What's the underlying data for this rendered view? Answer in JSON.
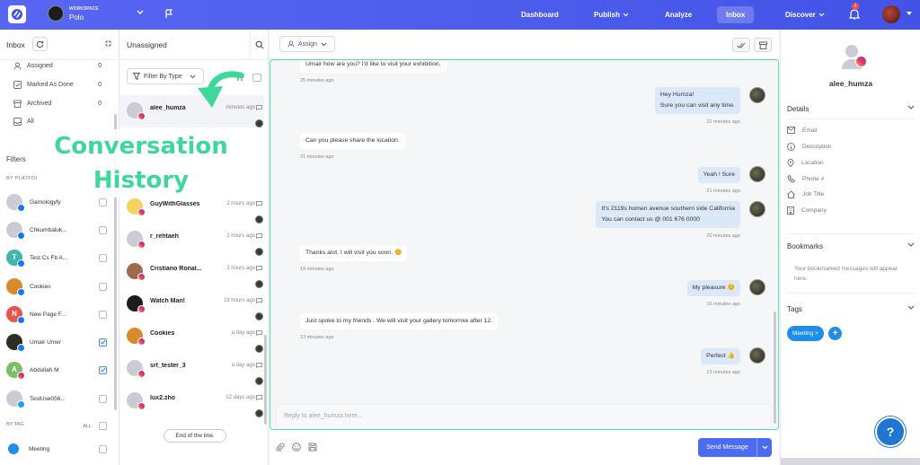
{
  "topbar": {
    "workspace_label": "WORKSPACE",
    "workspace_name": "Polo",
    "nav": [
      {
        "label": "Dashboard"
      },
      {
        "label": "Publish"
      },
      {
        "label": "Analyze"
      },
      {
        "label": "Inbox"
      },
      {
        "label": "Discover"
      }
    ],
    "notification_count": "1"
  },
  "inbox_panel": {
    "title": "Inbox",
    "items": [
      {
        "label": "Assigned",
        "count": "0"
      },
      {
        "label": "Marked As Done",
        "count": "0"
      },
      {
        "label": "Archived",
        "count": "0"
      },
      {
        "label": "All",
        "count": ""
      }
    ],
    "filters_title": "Filters",
    "by_platform_label": "BY PLATFOI",
    "accounts": [
      {
        "name": "Gamologyfy",
        "platform": "facebook",
        "checked": false,
        "avatar_color": "#c9ccd3"
      },
      {
        "name": "Chkumbaluk...",
        "platform": "facebook",
        "checked": false,
        "avatar_color": "#c9ccd3"
      },
      {
        "name": "Test Cs Fb A...",
        "platform": "facebook",
        "checked": false,
        "avatar_color": "#3fb6a8",
        "initial": "T"
      },
      {
        "name": "Cookies",
        "platform": "facebook",
        "checked": false,
        "avatar_color": "#d98a2b"
      },
      {
        "name": "New Page F...",
        "platform": "facebook",
        "checked": false,
        "avatar_color": "#e8534d",
        "initial": "N"
      },
      {
        "name": "Umair Umer",
        "platform": "facebook",
        "checked": true,
        "avatar_color": "#2d2d22"
      },
      {
        "name": "Abdullah M",
        "platform": "instagram",
        "checked": true,
        "avatar_color": "#7cbf6a",
        "initial": "A"
      },
      {
        "name": "TestUse056...",
        "platform": "twitter",
        "checked": false,
        "avatar_color": "#c9ccd3"
      }
    ],
    "by_tag_label": "BY TAG",
    "all_label": "ALL",
    "tags": [
      {
        "name": "Meeting",
        "color": "#1f8dea"
      }
    ]
  },
  "overlay": {
    "line1": "Conversation",
    "line2": "History"
  },
  "conversation_list": {
    "title": "Unassigned",
    "filter_label": "Filter By Type",
    "items": [
      {
        "name": "alee_humza",
        "time": "minutes ago",
        "avatar_color": "#c9ccd3",
        "platform": "instagram",
        "selected": true
      },
      {
        "name": "GuyWithGlasses",
        "time": "2 hours ago",
        "avatar_color": "#f4d35e",
        "platform": "instagram"
      },
      {
        "name": "r_rehtaeh",
        "time": "2 hours ago",
        "avatar_color": "#c9ccd3",
        "platform": "instagram"
      },
      {
        "name": "Cristiano Ronal...",
        "time": "2 hours ago",
        "avatar_color": "#a0694b",
        "platform": "instagram"
      },
      {
        "name": "Watch Man!",
        "time": "19 hours ago",
        "avatar_color": "#1d1d1d",
        "platform": "instagram"
      },
      {
        "name": "Cookies",
        "time": "a day ago",
        "avatar_color": "#d98a2b",
        "platform": "instagram"
      },
      {
        "name": "srt_tester_3",
        "time": "a day ago",
        "avatar_color": "#c9ccd3",
        "platform": "instagram"
      },
      {
        "name": "lux2.zho",
        "time": "12 days ago",
        "avatar_color": "#c9ccd3",
        "platform": "instagram"
      }
    ],
    "end_label": "End of the line."
  },
  "chat": {
    "assign_label": "Assign",
    "messages": [
      {
        "side": "in",
        "lines": [
          "Umair how are you? I'd like to visit your exhibition."
        ],
        "time": "25 minutes ago"
      },
      {
        "side": "out",
        "lines": [
          "Hey Humza!",
          "Sure you can visit any time."
        ],
        "time": "22 minutes ago"
      },
      {
        "side": "in",
        "lines": [
          "Can you please share the location."
        ],
        "time": "21 minutes ago"
      },
      {
        "side": "out",
        "lines": [
          "Yeah ! Sure"
        ],
        "time": "21 minutes ago"
      },
      {
        "side": "out",
        "lines": [
          "It's 2119s homen avenue southern side California",
          "You can contact us @ 001 676 0000"
        ],
        "time": "20 minutes ago"
      },
      {
        "side": "in",
        "lines": [
          "Thanks alot. I will visit you soon. 😊"
        ],
        "time": "19 minutes ago"
      },
      {
        "side": "out",
        "lines": [
          "My pleasure 😊"
        ],
        "time": "16 minutes ago"
      },
      {
        "side": "in",
        "lines": [
          "Just spoke to my friends . We will visit your gallery tomorrow after 12."
        ],
        "time": "13 minutes ago"
      },
      {
        "side": "out",
        "lines": [
          "Perfect 👍"
        ],
        "time": "13 minutes ago"
      }
    ],
    "reply_placeholder": "Reply to alee_humza here...",
    "send_label": "Send Message"
  },
  "profile": {
    "username": "alee_humza",
    "details_title": "Details",
    "details": [
      {
        "label": "Email",
        "icon": "mail-icon"
      },
      {
        "label": "Description",
        "icon": "info-icon"
      },
      {
        "label": "Location",
        "icon": "pin-icon"
      },
      {
        "label": "Phone #",
        "icon": "phone-icon"
      },
      {
        "label": "Job Title",
        "icon": "home-icon"
      },
      {
        "label": "Company",
        "icon": "building-icon"
      }
    ],
    "bookmarks_title": "Bookmarks",
    "bookmarks_text": "Your bookmarked messages will appear here.",
    "tags_title": "Tags",
    "tag": "Meeting",
    "tag_remove": "×",
    "help_label": "?"
  }
}
